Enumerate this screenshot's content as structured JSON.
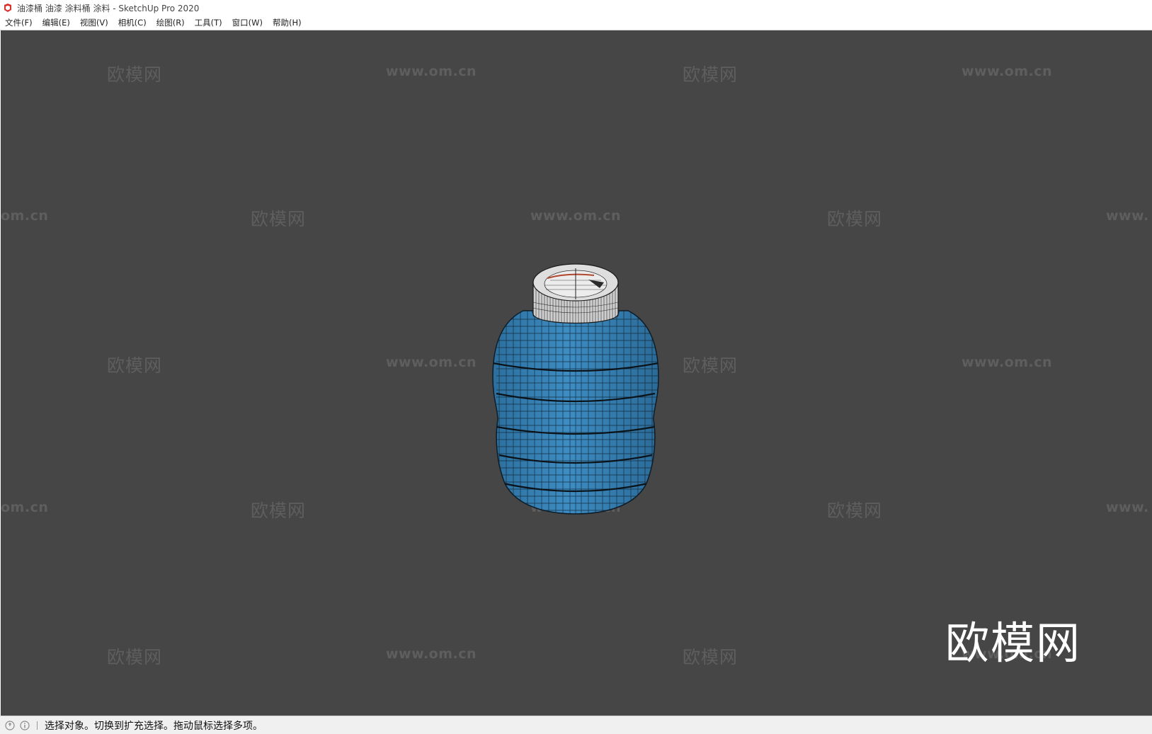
{
  "window": {
    "title": "油漆桶 油漆 涂料桶 涂料 - SketchUp Pro 2020"
  },
  "menu": [
    {
      "label": "文件(F)"
    },
    {
      "label": "编辑(E)"
    },
    {
      "label": "视图(V)"
    },
    {
      "label": "相机(C)"
    },
    {
      "label": "绘图(R)"
    },
    {
      "label": "工具(T)"
    },
    {
      "label": "窗口(W)"
    },
    {
      "label": "帮助(H)"
    }
  ],
  "watermarks": {
    "brand": "欧模网",
    "url": "www.om.cn",
    "url_left_cut": "om.cn",
    "url_right_cut": "www."
  },
  "logo": {
    "text": "欧模网"
  },
  "status": {
    "text": "选择对象。切换到扩充选择。拖动鼠标选择多项。"
  },
  "colors": {
    "viewport": "#464646",
    "barrel_body": "#3b85b8",
    "lid": "#d8d8d8"
  },
  "icons": {
    "app": "sketchup-icon",
    "geo": "geo-location-icon",
    "info": "info-icon"
  }
}
